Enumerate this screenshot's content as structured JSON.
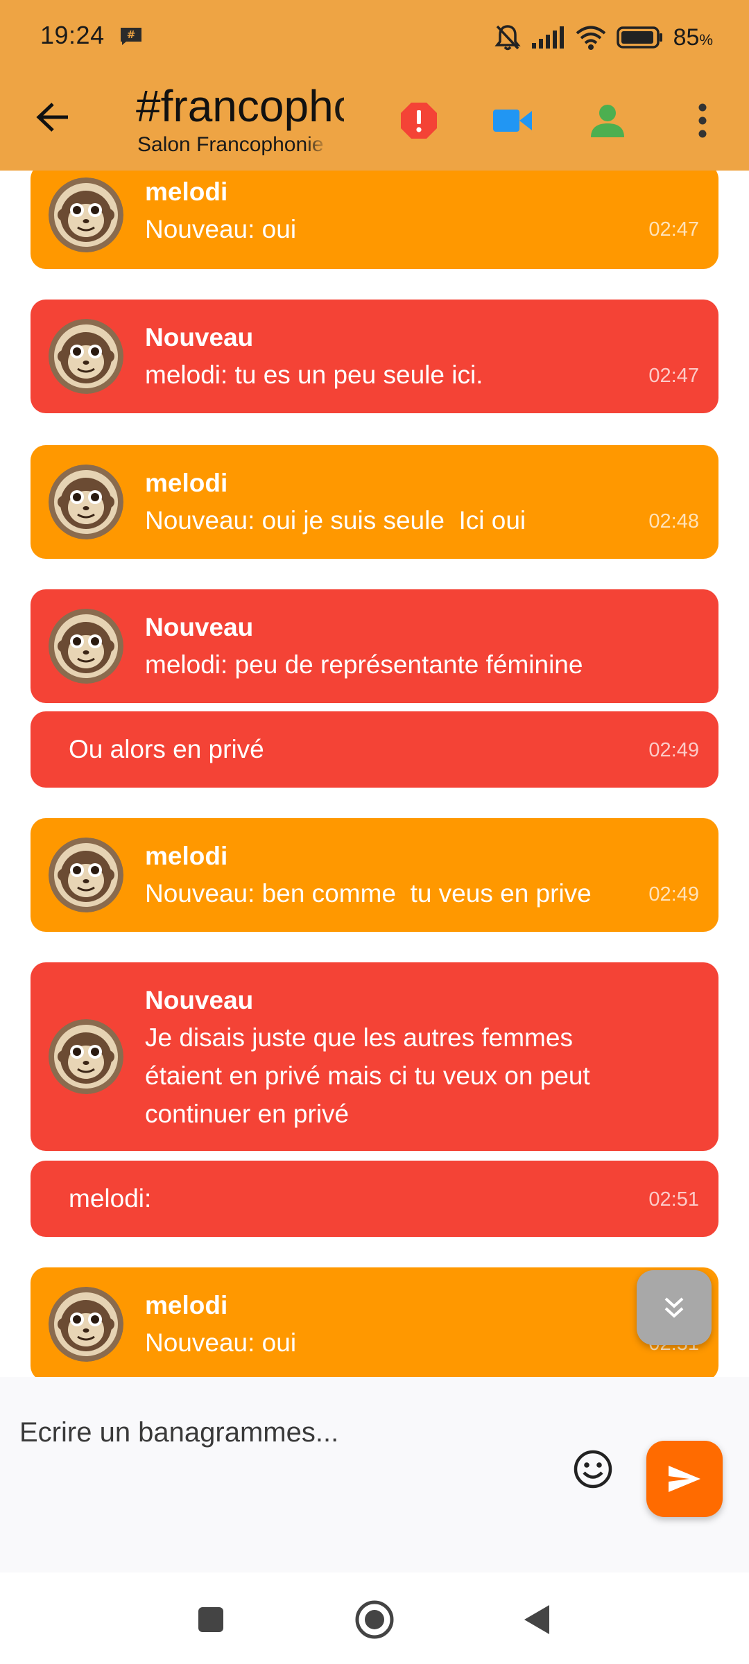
{
  "colors": {
    "header_bg": "#EEA444",
    "bubble_orange": "#FF9800",
    "bubble_red": "#F44336",
    "send_button": "#FF6B00",
    "alert_icon": "#F44336",
    "video_icon": "#2196F3",
    "person_icon": "#4CAF50"
  },
  "status_bar": {
    "time": "19:24",
    "battery_value": "85",
    "battery_unit": "%",
    "icons": [
      "chat-notification-icon",
      "bell-off-icon",
      "signal-icon",
      "wifi-icon",
      "battery-icon"
    ]
  },
  "app_bar": {
    "title": "#francophonie",
    "subtitle": "Salon Francophonie",
    "icons": [
      "back-arrow-icon",
      "alert-icon",
      "video-camera-icon",
      "person-icon",
      "more-vert-icon"
    ]
  },
  "messages": [
    {
      "sender": "melodi",
      "text": "Nouveau: oui",
      "time": "02:47"
    },
    {
      "sender": "Nouveau",
      "text": "melodi: tu es un peu seule ici.",
      "time": "02:47"
    },
    {
      "sender": "melodi",
      "text": "Nouveau: oui je suis seule  Ici oui",
      "time": "02:48"
    },
    {
      "sender": "Nouveau",
      "text": "melodi: peu de représentante féminine",
      "time": ""
    },
    {
      "sender": "",
      "text": "Ou alors en privé",
      "time": "02:49"
    },
    {
      "sender": "melodi",
      "text": "Nouveau: ben comme  tu veus en prive",
      "time": "02:49"
    },
    {
      "sender": "Nouveau",
      "text": "Je disais juste que les autres femmes\nétaient en privé mais ci tu veux on peut\ncontinuer en privé",
      "time": ""
    },
    {
      "sender": "",
      "text": "melodi:",
      "time": "02:51"
    },
    {
      "sender": "melodi",
      "text": "Nouveau: oui",
      "time": "02:51"
    }
  ],
  "composer": {
    "placeholder": "Ecrire un banagrammes...",
    "icons": [
      "emoji-icon",
      "send-icon"
    ]
  },
  "scroll_button": {
    "icon": "double-chevron-down-icon"
  },
  "nav_bar": {
    "icons": [
      "recents-square-icon",
      "home-circle-icon",
      "back-triangle-icon"
    ]
  }
}
